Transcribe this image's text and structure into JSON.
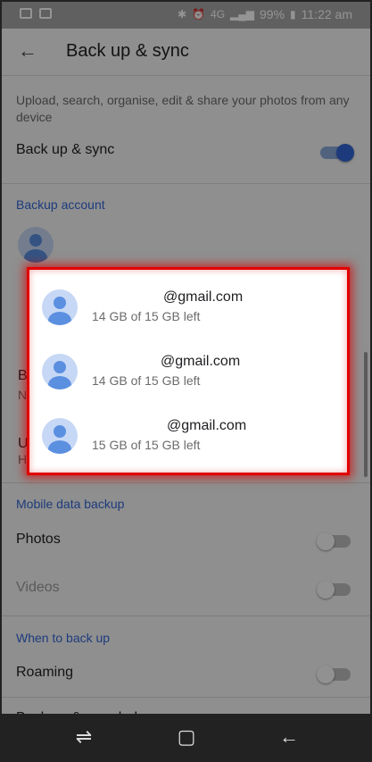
{
  "status_bar": {
    "battery": "99%",
    "time": "11:22 am",
    "network": "4G",
    "icons": [
      "image-icon",
      "cast-icon",
      "bluetooth-icon",
      "alarm-icon",
      "signal-icon",
      "battery-icon"
    ]
  },
  "app_bar": {
    "back_icon": "arrow-back-icon",
    "title": "Back up & sync"
  },
  "settings": {
    "description": "Upload, search, organise, edit & share your photos from any device",
    "backup_sync_label": "Back up & sync",
    "backup_sync_on": true,
    "backup_account_header": "Backup account",
    "partial_row_1_letter": "B",
    "partial_row_1_sub": "N",
    "partial_row_2_letter": "U",
    "partial_row_2_sub": "H",
    "mobile_data_header": "Mobile data backup",
    "photos_label": "Photos",
    "photos_on": false,
    "videos_label": "Videos",
    "videos_on": false,
    "when_header": "When to back up",
    "roaming_label": "Roaming",
    "roaming_on": false,
    "help_label": "Back up & sync help"
  },
  "account_dialog": {
    "accounts": [
      {
        "email": "@gmail.com",
        "storage": "14 GB of 15 GB left"
      },
      {
        "email": "@gmail.com",
        "storage": "14 GB of 15 GB left"
      },
      {
        "email": "@gmail.com",
        "storage": "15 GB of 15 GB left"
      }
    ],
    "highlight_color": "#e00000"
  },
  "nav_bar": {
    "buttons": [
      "recent-apps-icon",
      "home-icon",
      "back-icon"
    ]
  },
  "colors": {
    "accent": "#3367d6",
    "avatar_bg": "#c6d8f5"
  }
}
